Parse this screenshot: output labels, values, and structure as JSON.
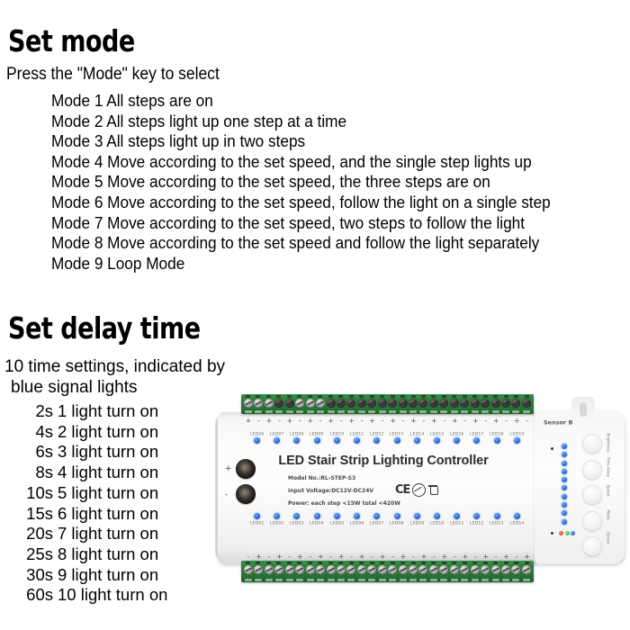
{
  "sections": {
    "set_mode": {
      "heading": "Set mode",
      "intro": "Press the \"Mode\" key to select",
      "modes": [
        "Mode 1 All steps are on",
        "Mode 2 All steps light up one step at a time",
        "Mode 3 All steps light up in two steps",
        "Mode 4 Move according to the set speed, and the single step lights up",
        "Mode 5 Move according to the set speed, the three steps are on",
        "Mode 6 Move according to the set speed, follow the light on a single step",
        "Mode 7 Move according to the set speed, two steps to follow the light",
        "Mode 8 Move according to the set speed and follow the light separately",
        "Mode 9 Loop Mode"
      ]
    },
    "set_delay": {
      "heading": "Set delay time",
      "intro_line1": "10 time settings, indicated by",
      "intro_line2": "blue signal lights",
      "entries": [
        {
          "time": "2s",
          "desc": "1 light turn on"
        },
        {
          "time": "4s",
          "desc": "2 light turn on"
        },
        {
          "time": "6s",
          "desc": "3 light turn on"
        },
        {
          "time": "8s",
          "desc": "4 light turn on"
        },
        {
          "time": "10s",
          "desc": "5 light turn on"
        },
        {
          "time": "15s",
          "desc": "6 light turn on"
        },
        {
          "time": "20s",
          "desc": "7 light turn on"
        },
        {
          "time": "25s",
          "desc": "8 light turn on"
        },
        {
          "time": "30s",
          "desc": "9 light turn on"
        },
        {
          "time": "60s",
          "desc": "10 light turn on"
        }
      ]
    }
  },
  "product": {
    "title": "LED Stair Strip Lighting Controller",
    "model": "Model No.:RL-STEP-S3",
    "voltage": "Input Voltage:DC12V-DC24V",
    "power": "Power: each step <15W  total <420W",
    "sensor_label": "Sensor B",
    "cert_marks": [
      "CE",
      "RoHS",
      "WEEE"
    ],
    "power_terminals": [
      {
        "sign": "+"
      },
      {
        "sign": "-"
      }
    ],
    "led_labels_top": [
      "LED06",
      "LED07",
      "LED08",
      "LED09",
      "LED10",
      "LED11",
      "LED12",
      "LED13",
      "LED14",
      "LED15",
      "LED16",
      "LED17",
      "LED18",
      "LED19"
    ],
    "led_labels_bottom": [
      "LED01",
      "LED02",
      "LED03",
      "LED04",
      "LED05",
      "LED06",
      "LED07",
      "LED08",
      "LED09",
      "LED10",
      "LED11",
      "LED12",
      "LED13",
      "LED14"
    ],
    "polarity_top": [
      "+",
      "-",
      "+",
      "-",
      "+",
      "-",
      "+",
      "-",
      "+",
      "-",
      "+",
      "-",
      "+",
      "-",
      "+",
      "-",
      "+",
      "-",
      "+",
      "-",
      "+",
      "-",
      "+",
      "-",
      "+",
      "-",
      "+",
      "-"
    ],
    "polarity_bottom": [
      "-",
      "+",
      "-",
      "+",
      "-",
      "+",
      "-",
      "+",
      "-",
      "+",
      "-",
      "+",
      "-",
      "+",
      "-",
      "+",
      "-",
      "+",
      "-",
      "+",
      "-",
      "+",
      "-",
      "+",
      "-",
      "+",
      "-",
      "+"
    ],
    "terminal_count": 28,
    "signal_light_count": 10,
    "rgb_indicators": [
      "red",
      "green",
      "blue"
    ],
    "buttons": [
      {
        "label": "Brightness"
      },
      {
        "label": "Time delay"
      },
      {
        "label": "Speed"
      },
      {
        "label": "Mode"
      },
      {
        "label": "Sensor"
      }
    ],
    "colors": {
      "terminal_green": "#2f7d3c",
      "led_blue": "#2a6ddb",
      "body_white": "#fafafa",
      "indicator_red": "#d82a14",
      "indicator_green": "#18aa20"
    }
  }
}
